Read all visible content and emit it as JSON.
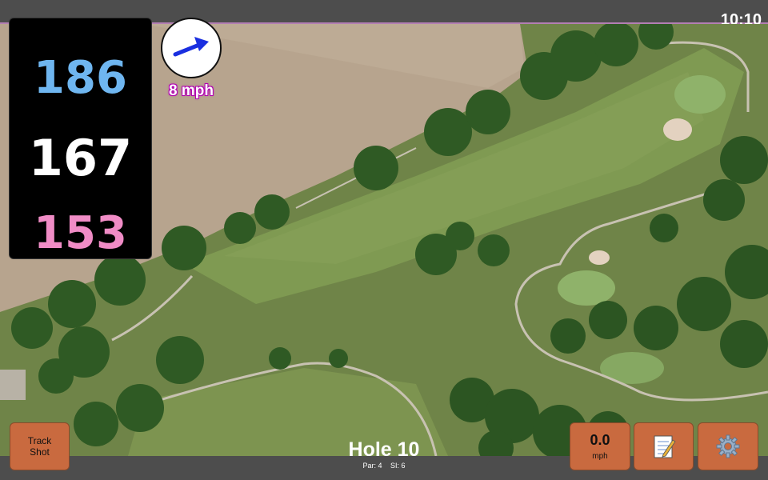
{
  "status": {
    "time": "10:10"
  },
  "yardage": {
    "back": "186",
    "center": "167",
    "front": "153"
  },
  "wind": {
    "speed_label": "8 mph",
    "icon": "wind-direction-arrow-icon"
  },
  "buttons": {
    "track_shot_line1": "Track",
    "track_shot_line2": "Shot",
    "speed_value": "0.0",
    "speed_unit": "mph",
    "notes_icon": "notepad-icon",
    "settings_icon": "gear-icon"
  },
  "hole": {
    "title": "Hole 10",
    "par_label": "Par: 4",
    "si_label": "SI: 6"
  },
  "colors": {
    "back_yardage": "#6fb6f0",
    "front_yardage": "#f08cc6",
    "button": "#c96a3f",
    "wind_outline": "#b200b2"
  }
}
